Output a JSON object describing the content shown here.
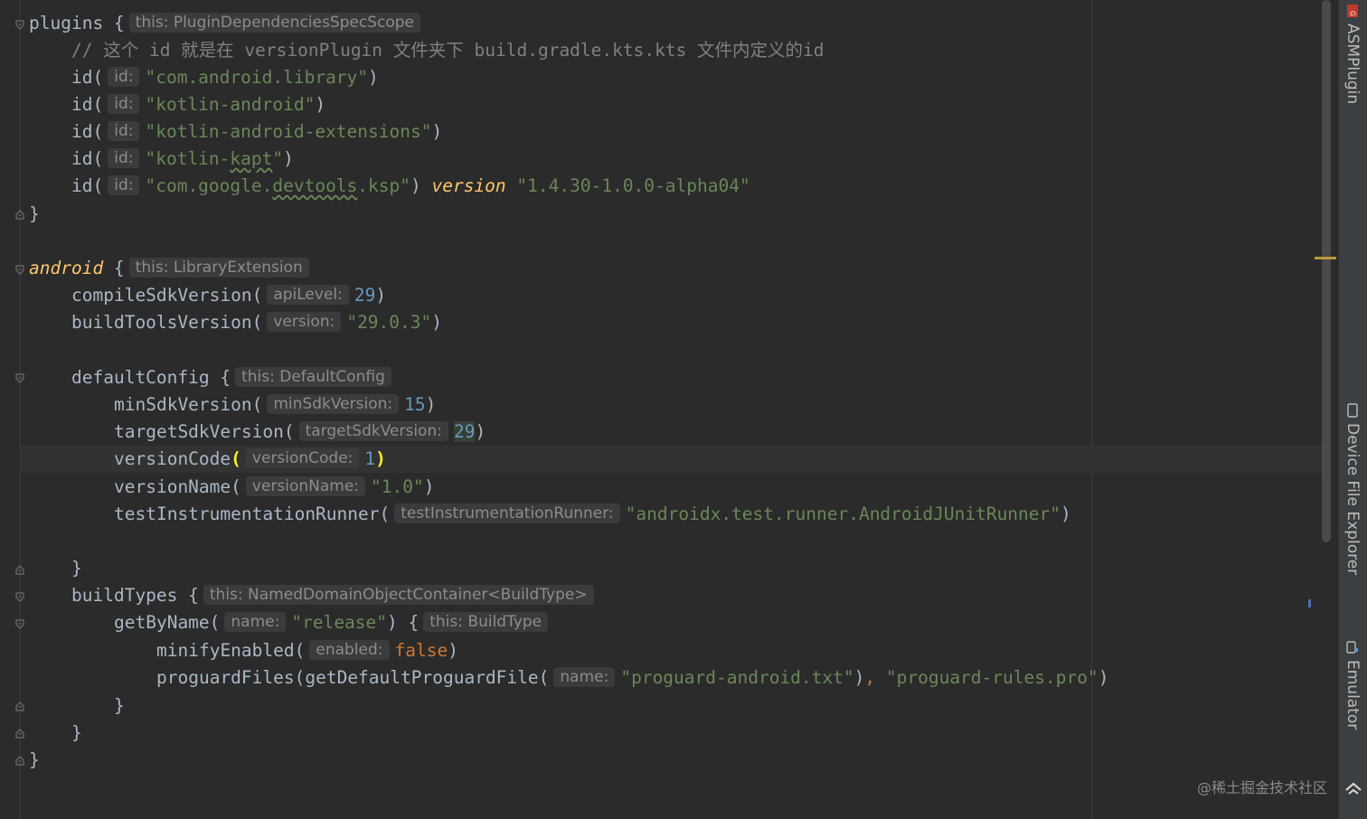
{
  "colors": {
    "background": "#2b2b2b",
    "keyword": "#cc7832",
    "string": "#6a8759",
    "number": "#6897bb",
    "comment": "#808080",
    "hint_bg": "#3b3b3b"
  },
  "code": {
    "l1": {
      "name": "plugins",
      "brace": " {",
      "hint": "this: PluginDependenciesSpecScope"
    },
    "l2": {
      "comment": "// 这个 id 就是在 versionPlugin 文件夹下 build.gradle.kts.kts 文件内定义的id"
    },
    "l3": {
      "fn": "id(",
      "hint": "id:",
      "str": "\"com.android.library\"",
      "close": ")"
    },
    "l4": {
      "fn": "id(",
      "hint": "id:",
      "str": "\"kotlin-android\"",
      "close": ")"
    },
    "l5": {
      "fn": "id(",
      "hint": "id:",
      "str": "\"kotlin-android-extensions\"",
      "close": ")"
    },
    "l6": {
      "fn": "id(",
      "hint": "id:",
      "str_a": "\"kotlin-",
      "str_b": "kapt",
      "str_c": "\"",
      "close": ")"
    },
    "l7": {
      "fn": "id(",
      "hint": "id:",
      "str_a": "\"com.google.",
      "str_b": "devtools",
      "str_c": ".ksp\"",
      "close": ") ",
      "kw": "version",
      "ver": "\"1.4.30-1.0.0-alpha04\""
    },
    "l8": {
      "brace": "}"
    },
    "l10": {
      "name": "android",
      "brace": " {",
      "hint": "this: LibraryExtension"
    },
    "l11": {
      "fn": "compileSdkVersion(",
      "hint": "apiLevel:",
      "num": "29",
      "close": ")"
    },
    "l12": {
      "fn": "buildToolsVersion(",
      "hint": "version:",
      "str": "\"29.0.3\"",
      "close": ")"
    },
    "l14": {
      "fn": "defaultConfig {",
      "hint": "this: DefaultConfig"
    },
    "l15": {
      "fn": "minSdkVersion(",
      "hint": "minSdkVersion:",
      "num": "15",
      "close": ")"
    },
    "l16": {
      "fn": "targetSdkVersion(",
      "hint": "targetSdkVersion:",
      "num": "29",
      "close": ")"
    },
    "l17": {
      "fn": "versionCode",
      "open": "(",
      "hint": "versionCode:",
      "num": "1",
      "close": ")"
    },
    "l18": {
      "fn": "versionName(",
      "hint": "versionName:",
      "str": "\"1.0\"",
      "close": ")"
    },
    "l19": {
      "fn": "testInstrumentationRunner(",
      "hint": "testInstrumentationRunner:",
      "str": "\"androidx.test.runner.AndroidJUnitRunner\"",
      "close": ")"
    },
    "l21": {
      "brace": "}"
    },
    "l22": {
      "fn": "buildTypes {",
      "hint": "this: NamedDomainObjectContainer<BuildType>"
    },
    "l23": {
      "fn": "getByName(",
      "hint": "name:",
      "str": "\"release\"",
      "close": ") {",
      "hint2": "this: BuildType"
    },
    "l24": {
      "fn": "minifyEnabled(",
      "hint": "enabled:",
      "kw": "false",
      "close": ")"
    },
    "l25": {
      "fn": "proguardFiles(getDefaultProguardFile(",
      "hint": "name:",
      "str": "\"proguard-android.txt\"",
      "mid": "), ",
      "sep": ",",
      "str2": "\"proguard-rules.pro\"",
      "close": ")"
    },
    "l26": {
      "brace": "}"
    },
    "l27": {
      "brace": "}"
    },
    "l28": {
      "brace": "}"
    }
  },
  "tool_windows": {
    "asm": "ASMPlugin",
    "device": "Device File Explorer",
    "emulator": "Emulator"
  },
  "watermark": "@稀土掘金技术社区"
}
